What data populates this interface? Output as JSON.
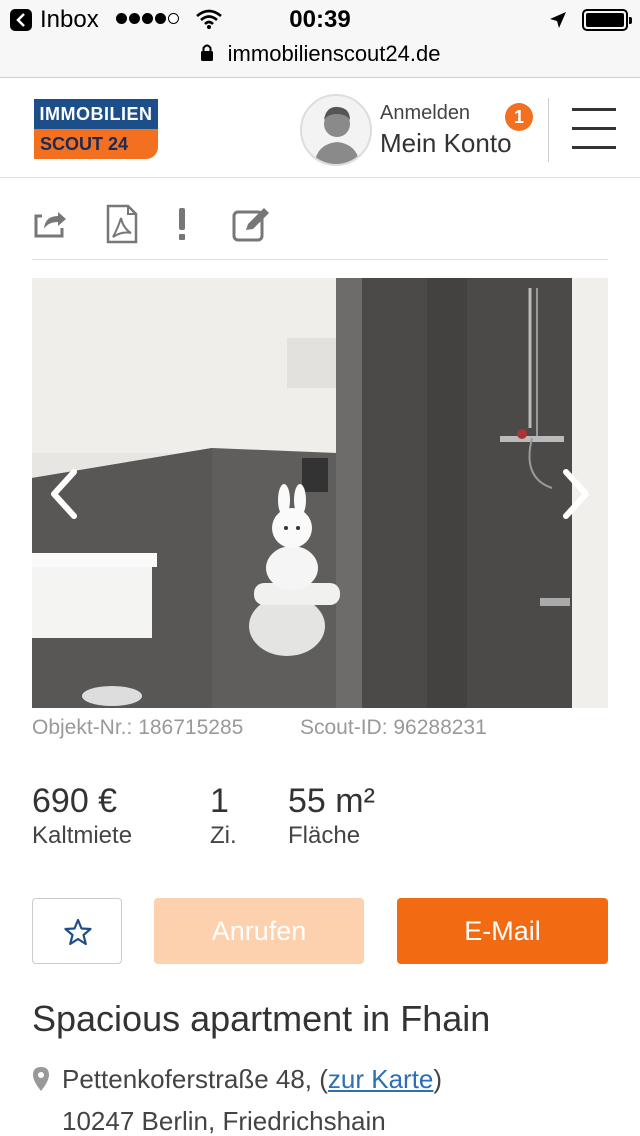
{
  "statusbar": {
    "back_app": "Inbox",
    "time": "00:39"
  },
  "browser": {
    "url": "immobilienscout24.de"
  },
  "header": {
    "logo_line1": "IMMOBILIEN",
    "logo_line2": "SCOUT 24",
    "login_label": "Anmelden",
    "account_label": "Mein Konto",
    "notification_count": "1"
  },
  "toolbar": {
    "icons": [
      "share-icon",
      "pdf-icon",
      "report-icon",
      "edit-note-icon"
    ]
  },
  "listing": {
    "objekt_nr": "Objekt-Nr.: 186715285",
    "scout_id": "Scout-ID: 96288231",
    "facts": [
      {
        "value": "690 €",
        "label": "Kaltmiete"
      },
      {
        "value": "1",
        "label": "Zi."
      },
      {
        "value": "55 m²",
        "label": "Fläche"
      }
    ],
    "buttons": {
      "call": "Anrufen",
      "email": "E-Mail"
    },
    "title": "Spacious apartment in Fhain",
    "address": {
      "street": "Pettenkoferstraße 48, (",
      "map_link": "zur Karte",
      "street_close": ")",
      "city": "10247 Berlin, Friedrichshain"
    }
  },
  "colors": {
    "brand_blue": "#1c4e8a",
    "brand_orange": "#f37021",
    "email_button": "#f26a12",
    "call_button_disabled": "#fdd1ae",
    "link": "#2d6fb4"
  }
}
